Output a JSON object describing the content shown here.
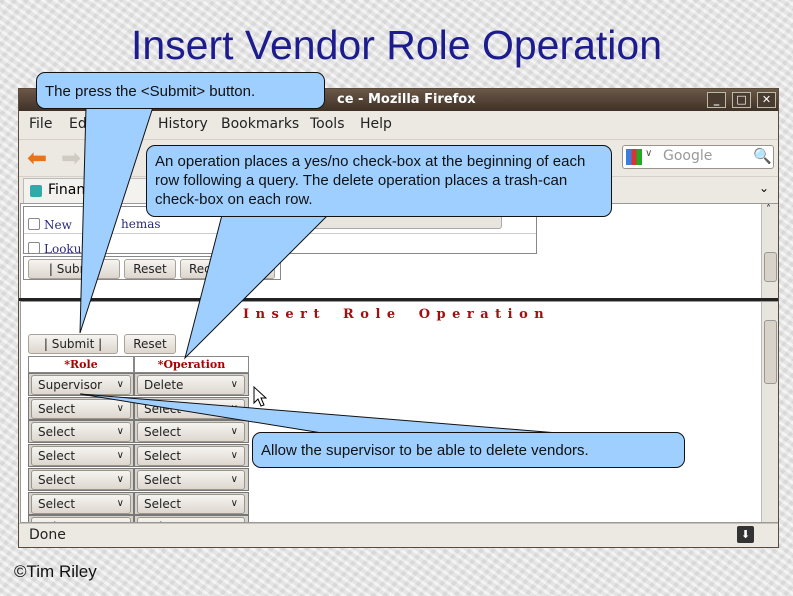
{
  "slide": {
    "title": "Insert Vendor Role Operation",
    "copyright": "©Tim Riley"
  },
  "browser": {
    "window_title": "ce - Mozilla Firefox",
    "window_buttons": [
      "minimize",
      "maximize",
      "close"
    ],
    "menu": [
      "File",
      "Ed",
      "History",
      "Bookmarks",
      "Tools",
      "Help"
    ],
    "search_placeholder": "Google",
    "tab_label": "Finan",
    "status": "Done"
  },
  "top_frame": {
    "checkbox_items": [
      "New",
      "Lookup"
    ],
    "partial_link": "hemas",
    "buttons": [
      "|   Subm   |",
      "Reset",
      "Rec"
    ]
  },
  "form": {
    "heading": "Insert Role Operation",
    "submit_label": "|   Submit   |",
    "reset_label": "Reset",
    "columns": [
      "*Role",
      "*Operation"
    ],
    "rows": [
      [
        "Supervisor",
        "Delete"
      ],
      [
        "Select",
        "Select"
      ],
      [
        "Select",
        "Select"
      ],
      [
        "Select",
        "Select"
      ],
      [
        "Select",
        "Select"
      ],
      [
        "Select",
        "Select"
      ],
      [
        "Select",
        "Select"
      ]
    ]
  },
  "callouts": {
    "submit": "The press the <Submit> button.",
    "operation": "An operation places a yes/no check-box at the beginning of each row following a query. The delete operation places a trash-can check-box on each row.",
    "supervisor": "Allow the supervisor to be able to delete vendors."
  },
  "colors": {
    "title": "#1c1c8e",
    "callout": "#9fcfff",
    "heading": "#a01010",
    "titlebar": "#4a3b30"
  }
}
